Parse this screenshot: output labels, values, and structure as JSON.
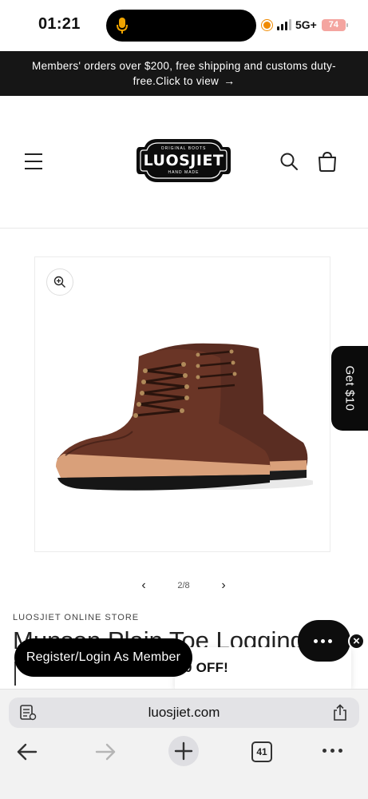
{
  "status_bar": {
    "time": "01:21",
    "network": "5G+",
    "battery": "74"
  },
  "announcement": {
    "text": "Members' orders over $200, free shipping and customs duty-free.Click to view"
  },
  "header": {
    "logo_top_text": "ORIGINAL BOOTS",
    "logo_name": "LUOSJIET",
    "logo_bottom_text": "HAND MADE"
  },
  "product": {
    "image_alt": "Brown leather lace-up boots",
    "page_indicator": "2/8",
    "store_label": "LUOSJIET ONLINE STORE",
    "title": "Munson Plain Toe Logging"
  },
  "floating": {
    "get_offer_label": "Get $10",
    "register_label": "Register/Login As Member",
    "promo_text": "0 OFF!",
    "close_label": "×"
  },
  "browser": {
    "url": "luosjiet.com",
    "tab_count": "41"
  },
  "colors": {
    "announcement_bg": "#161616",
    "accent_black": "#000000",
    "boot_leather": "#5b2f22",
    "boot_welt": "#d9a07a"
  }
}
